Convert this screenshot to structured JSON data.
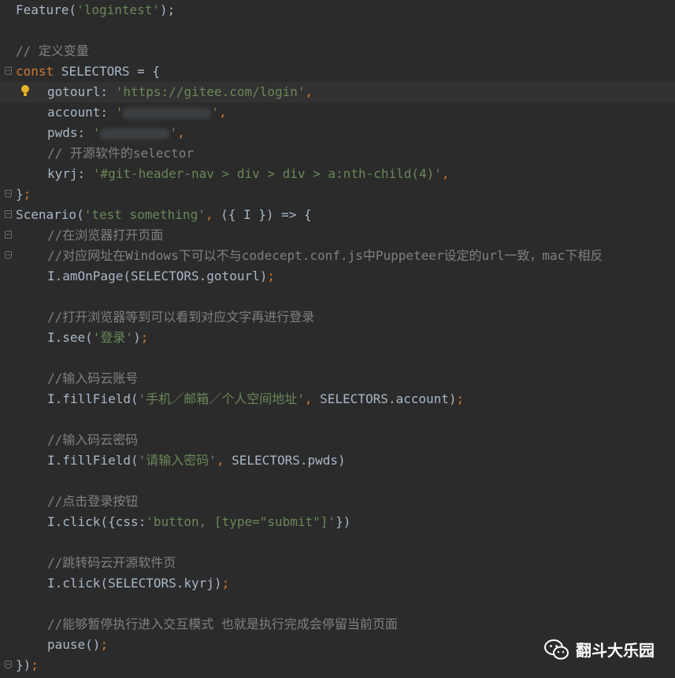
{
  "code": {
    "l1": {
      "fn": "Feature(",
      "str": "'logintest'",
      "end": ");"
    },
    "l3": {
      "comment": "// 定义变量"
    },
    "l4": {
      "kw": "const",
      "rest": " SELECTORS = {"
    },
    "l5": {
      "key": "gotourl: ",
      "str": "'https://gitee.com/login'",
      "end": ","
    },
    "l6": {
      "key": "account: ",
      "str_open": "'",
      "str_close": "'",
      "end": ","
    },
    "l7": {
      "key": "pwds: ",
      "str_open": "'",
      "str_close": "'",
      "end": ","
    },
    "l8": {
      "comment": "// 开源软件的selector"
    },
    "l9": {
      "key": "kyrj: ",
      "str": "'#git-header-nav > div > div > a:nth-child(4)'",
      "end": ","
    },
    "l10": {
      "text": "}",
      "end": ";"
    },
    "l11": {
      "fn": "Scenario(",
      "str": "'test something'",
      "comma": ", ",
      "rest": "({ I }) => {"
    },
    "l12": {
      "comment": "//在浏览器打开页面"
    },
    "l13": {
      "comment": "//对应网址在Windows下可以不与codecept.conf.js中Puppeteer设定的url一致，mac下相反"
    },
    "l14": {
      "text": "I.amOnPage(SELECTORS.gotourl)",
      "end": ";"
    },
    "l16": {
      "comment": "//打开浏览器等到可以看到对应文字再进行登录"
    },
    "l17": {
      "fn": "I.see(",
      "str": "'登录'",
      "close": ")",
      "end": ";"
    },
    "l19": {
      "comment": "//输入码云账号"
    },
    "l20": {
      "fn": "I.fillField(",
      "str": "'手机／邮箱／个人空间地址'",
      "comma": ", ",
      "rest": "SELECTORS.account)",
      "end": ";"
    },
    "l22": {
      "comment": "//输入码云密码"
    },
    "l23": {
      "fn": "I.fillField(",
      "str": "'请输入密码'",
      "comma": ", ",
      "rest": "SELECTORS.pwds)"
    },
    "l25": {
      "comment": "//点击登录按钮"
    },
    "l26": {
      "fn": "I.click({css:",
      "str": "'button, [type=\"submit\"]'",
      "rest": "})"
    },
    "l28": {
      "comment": "//跳转码云开源软件页"
    },
    "l29": {
      "text": "I.click(SELECTORS.kyrj)",
      "end": ";"
    },
    "l31": {
      "comment": "//能够暂停执行进入交互模式 也就是执行完成会停留当前页面"
    },
    "l32": {
      "text": "pause()",
      "end": ";"
    },
    "l33": {
      "text": "})",
      "end": ";"
    }
  },
  "watermark": {
    "text": "翻斗大乐园"
  },
  "colors": {
    "background": "#2b2b2b",
    "keyword": "#cc7832",
    "string": "#6a8759",
    "comment": "#808080",
    "default": "#a9b7c6"
  }
}
